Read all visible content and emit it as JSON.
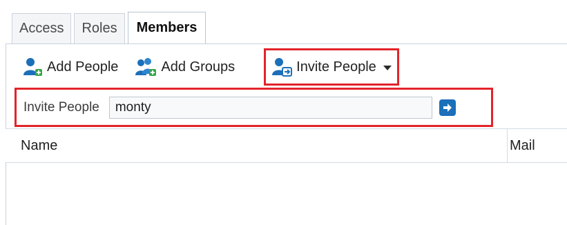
{
  "tabs": [
    {
      "label": "Access",
      "active": false
    },
    {
      "label": "Roles",
      "active": false
    },
    {
      "label": "Members",
      "active": true
    }
  ],
  "toolbar": {
    "add_people_label": "Add People",
    "add_groups_label": "Add Groups",
    "invite_people_label": "Invite People",
    "icons": {
      "add_people": "add-person-icon",
      "add_groups": "add-group-icon",
      "invite_people": "invite-person-icon",
      "invite_dropdown": "caret-down-icon"
    }
  },
  "invite": {
    "label": "Invite People",
    "value": "monty",
    "go_icon": "arrow-right-icon"
  },
  "table": {
    "columns": [
      "Name",
      "Mail"
    ],
    "rows": []
  },
  "colors": {
    "highlight": "#e2232a",
    "icon_blue": "#1c6fb9",
    "icon_green": "#3aa548"
  }
}
